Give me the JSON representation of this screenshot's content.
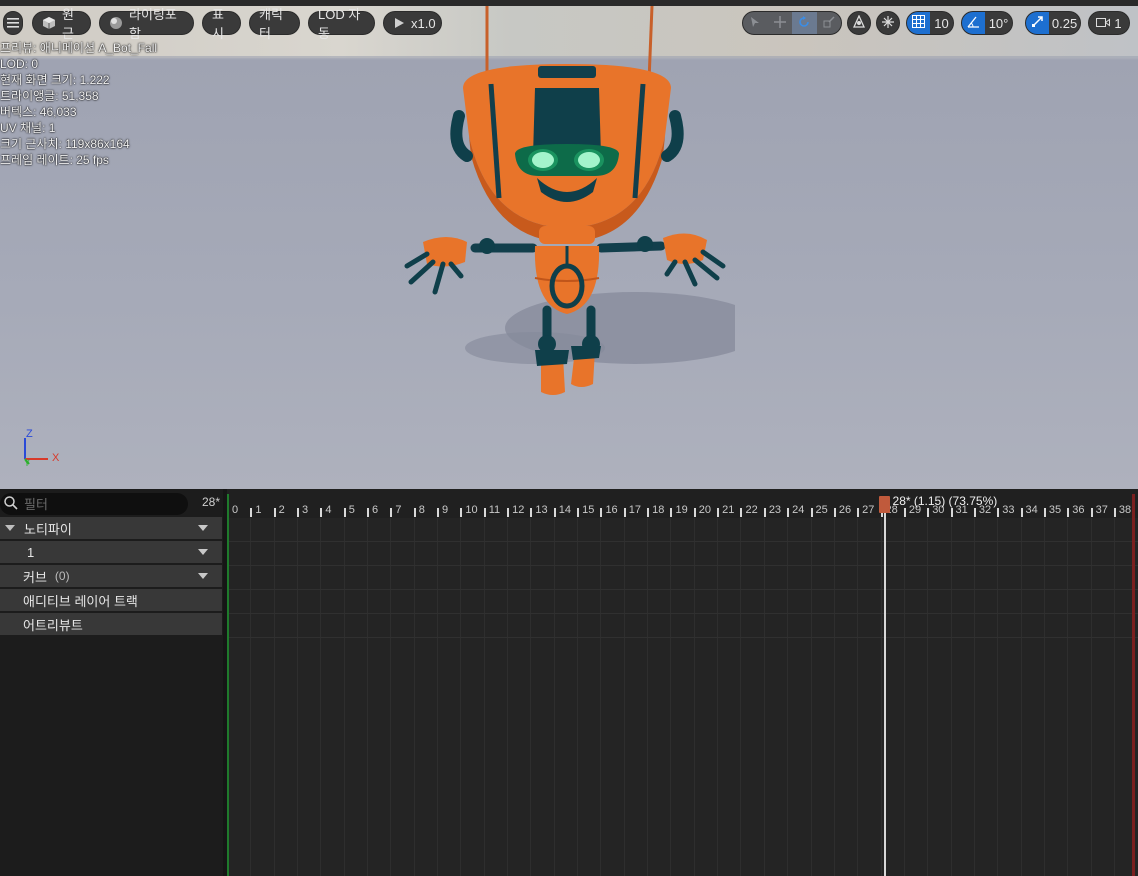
{
  "toolbar": {
    "perspective": "원근",
    "lighting": "라이팅포함",
    "show": "표시",
    "character": "캐릭터",
    "lod": "LOD 자동",
    "play_speed": "x1.0",
    "grid_snap": "10",
    "rotation_snap": "10°",
    "scale_snap": "0.25",
    "camera_speed": "1"
  },
  "stats": {
    "preview": "프리뷰: 애니메이션 A_Bot_Fall",
    "lod": "LOD: 0",
    "screen_size": "현재 화면 크기: 1.222",
    "triangles": "트라이앵글: 51,358",
    "vertices": "버텍스: 46,033",
    "uv_channels": "UV 채널: 1",
    "approx_size": "크기 근사치: 119x86x164",
    "frame_rate": "프레임 레이트: 25 fps"
  },
  "axes": {
    "z": "Z",
    "x": "X",
    "y": "Y"
  },
  "panel": {
    "search_placeholder": "필터",
    "frame_count": "28*",
    "tracks": [
      {
        "label": "노티파이"
      },
      {
        "label": "1"
      },
      {
        "label": "커브",
        "count": "(0)"
      },
      {
        "label": "애디티브 레이어 트랙"
      },
      {
        "label": "어트리뷰트"
      }
    ]
  },
  "timeline": {
    "frames": [
      "0",
      "1",
      "2",
      "3",
      "4",
      "5",
      "6",
      "7",
      "8",
      "9",
      "10",
      "11",
      "12",
      "13",
      "14",
      "15",
      "16",
      "17",
      "18",
      "19",
      "20",
      "21",
      "22",
      "23",
      "24",
      "25",
      "26",
      "27",
      "28",
      "29",
      "30",
      "31",
      "32",
      "33",
      "34",
      "35",
      "36",
      "37",
      "38"
    ],
    "current_frame": 28,
    "playhead_label": "28* (1.15) (73.75%)"
  },
  "colors": {
    "accent_blue": "#1d6fd0",
    "robot_orange": "#e8742a",
    "robot_dark": "#0f3f4a",
    "eye_green": "#16c46a",
    "playhead": "#c05a3c"
  }
}
